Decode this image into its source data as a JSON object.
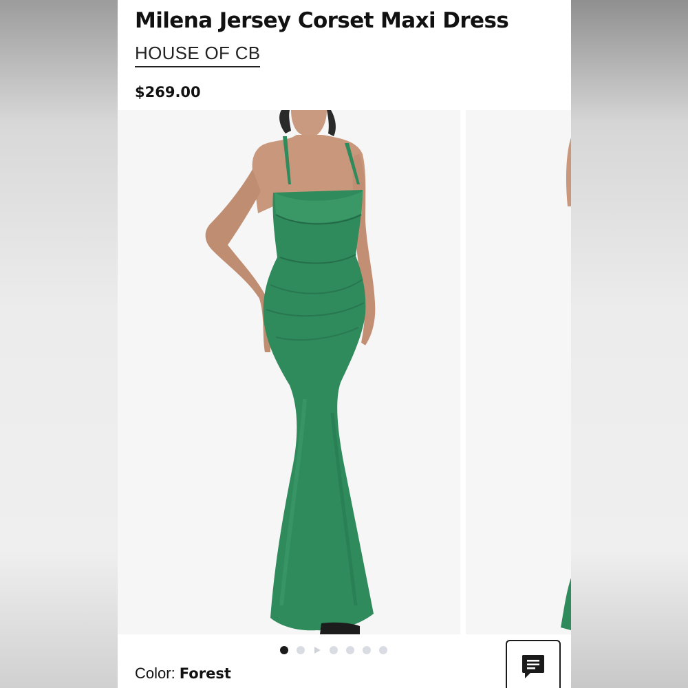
{
  "product": {
    "title": "Milena Jersey Corset Maxi Dress",
    "brand": "HOUSE OF CB",
    "price": "$269.00"
  },
  "gallery": {
    "image_count": 7,
    "active_index": 0,
    "video_index": 2,
    "dress_color_hex": "#2f8a5c"
  },
  "color": {
    "label": "Color: ",
    "value": "Forest"
  },
  "chat": {
    "icon": "chat-icon"
  },
  "colors": {
    "text": "#111111",
    "dot_active": "#1a1a1a",
    "dot_inactive": "#d9dde3",
    "dress": "#2f8a5c"
  }
}
